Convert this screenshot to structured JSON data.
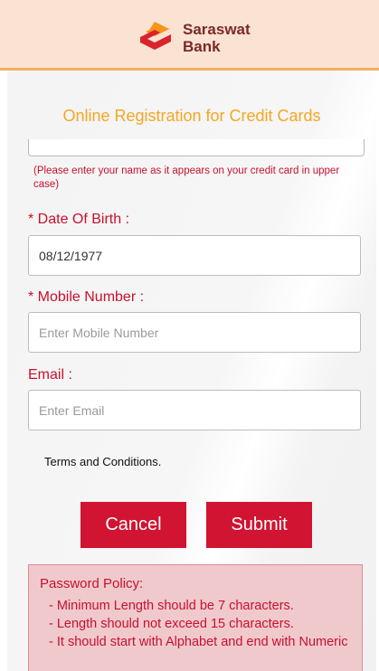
{
  "header": {
    "brand_line1": "Saraswat",
    "brand_line2": "Bank"
  },
  "form": {
    "title": "Online Registration for Credit Cards",
    "name_hint": "(Please enter your name as it appears on your credit card in upper case)",
    "dob": {
      "label": "* Date Of Birth :",
      "value": "08/12/1977"
    },
    "mobile": {
      "label": "* Mobile Number :",
      "placeholder": "Enter Mobile Number"
    },
    "email": {
      "label": "Email :",
      "placeholder": "Enter Email"
    },
    "terms": "Terms and Conditions.",
    "cancel_label": "Cancel",
    "submit_label": "Submit"
  },
  "policy": {
    "title": "Password Policy:",
    "rules": [
      "- Minimum Length should be 7 characters.",
      "- Length should not exceed 15 characters.",
      "- It should start with Alphabet and end with Numeric"
    ]
  },
  "colors": {
    "brand_red": "#d01431",
    "title_orange": "#f5a623",
    "header_bg": "#fbe3d3"
  }
}
